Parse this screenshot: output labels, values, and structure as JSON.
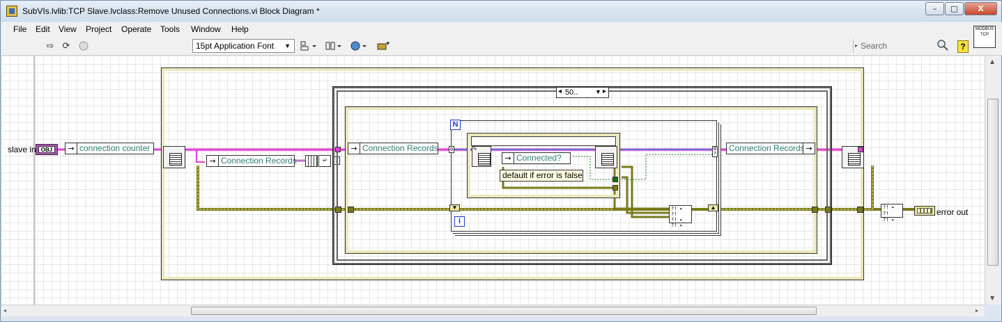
{
  "window": {
    "title": "SubVIs.lvlib:TCP Slave.lvclass:Remove Unused Connections.vi Block Diagram *",
    "controls": {
      "minimize": "–",
      "maximize": "□",
      "close": "X"
    }
  },
  "menu": {
    "items": [
      "File",
      "Edit",
      "View",
      "Project",
      "Operate",
      "Tools",
      "Window",
      "Help"
    ]
  },
  "toolbar": {
    "font": "15pt Application Font",
    "search_placeholder": "Search",
    "help": "?",
    "vi_icon_text": "MODBUS TCP"
  },
  "diagram": {
    "slave_in": "slave in",
    "obj_tag": "OBJ",
    "connection_counter": "connection counter",
    "connection_records_1": "Connection Records",
    "connection_records_2": "Connection Records",
    "connection_records_3": "Connection Records",
    "case_selector": "50..",
    "loop_count": "N",
    "loop_index": "i",
    "connected": "Connected?",
    "default_if_error": "default if error is false",
    "error_out": "error out"
  },
  "colors": {
    "class_wire": "#e23ecf",
    "error_wire": "#7a7a1a",
    "string_text": "#2e7d7a",
    "loop_blue": "#1a3fd0"
  }
}
